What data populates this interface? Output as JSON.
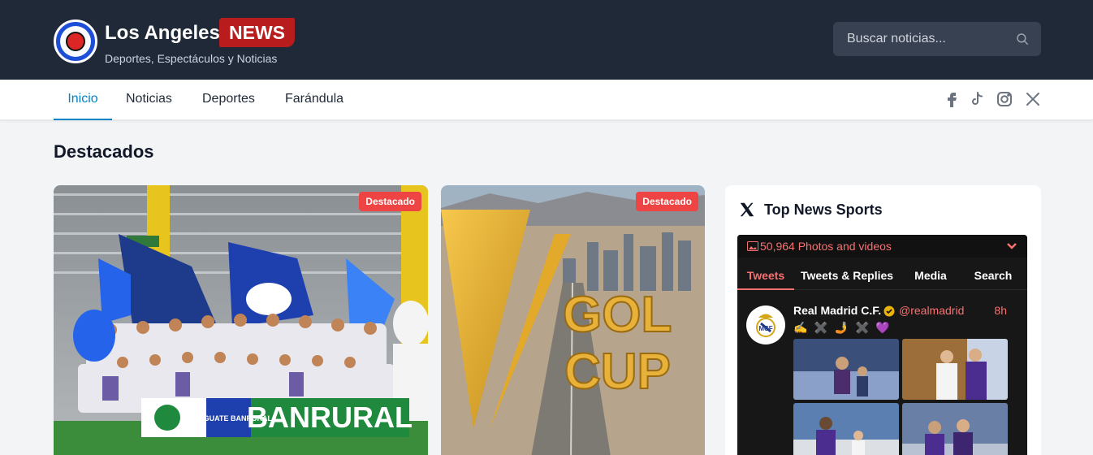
{
  "header": {
    "brand_name": "Los Angeles",
    "brand_badge": "NEWS",
    "tagline": "Deportes, Espectáculos y Noticias",
    "search_placeholder": "Buscar noticias..."
  },
  "nav": {
    "items": [
      {
        "label": "Inicio",
        "active": true
      },
      {
        "label": "Noticias",
        "active": false
      },
      {
        "label": "Deportes",
        "active": false
      },
      {
        "label": "Farándula",
        "active": false
      }
    ],
    "social_icons": [
      "facebook-icon",
      "tiktok-icon",
      "instagram-icon",
      "x-icon"
    ]
  },
  "featured": {
    "title": "Destacados",
    "cards": [
      {
        "badge": "Destacado",
        "banner_text": "BANRURAL",
        "sub_banner": "LIGA GUATE BANRURAL"
      },
      {
        "badge": "Destacado",
        "overlay_text": "GOLD CUP"
      }
    ]
  },
  "widget": {
    "title": "Top News Sports",
    "photos_label": "50,964 Photos and videos",
    "tabs": [
      "Tweets",
      "Tweets & Replies",
      "Media",
      "Search"
    ],
    "active_tab": "Tweets",
    "tweet": {
      "name": "Real Madrid C.F.",
      "handle": "@realmadrid",
      "time": "8h",
      "emojis": "✍️ ✖️ 🤳 ✖️ 💜"
    }
  },
  "colors": {
    "header_bg": "#1f2937",
    "accent_blue": "#0284c7",
    "badge_red": "#ef4444",
    "brand_red": "#b91c1c",
    "feed_bg": "#171717",
    "feed_accent": "#f87171"
  }
}
